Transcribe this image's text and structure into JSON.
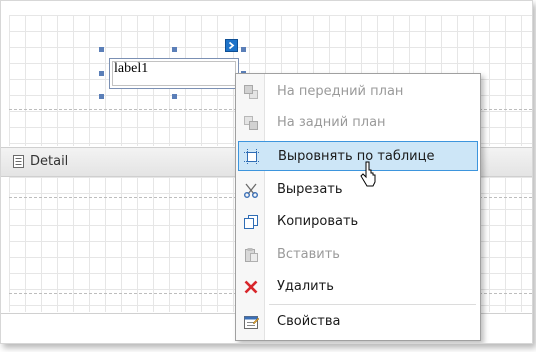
{
  "report": {
    "label_text": "label1",
    "detail_band_label": "Detail",
    "detail_icon": "band-icon"
  },
  "smart_tag": {
    "icon": "chevron-right-icon"
  },
  "context_menu": {
    "items": [
      {
        "label": "На передний план",
        "icon": "bring-to-front-icon",
        "enabled": false
      },
      {
        "label": "На задний план",
        "icon": "send-to-back-icon",
        "enabled": false
      },
      {
        "label": "Выровнять по таблице",
        "icon": "align-to-grid-icon",
        "enabled": true,
        "highlighted": true
      },
      {
        "label": "Вырезать",
        "icon": "cut-icon",
        "enabled": true
      },
      {
        "label": "Копировать",
        "icon": "copy-icon",
        "enabled": true
      },
      {
        "label": "Вставить",
        "icon": "paste-icon",
        "enabled": false
      },
      {
        "label": "Удалить",
        "icon": "delete-icon",
        "enabled": true
      },
      {
        "label": "Свойства",
        "icon": "properties-icon",
        "enabled": true
      }
    ]
  },
  "colors": {
    "highlight_bg": "#cde6f7",
    "highlight_border": "#3d95dd",
    "delete_red": "#d8262b",
    "disabled_text": "#9a9a9a",
    "selection_handle": "#5b7fb8"
  }
}
